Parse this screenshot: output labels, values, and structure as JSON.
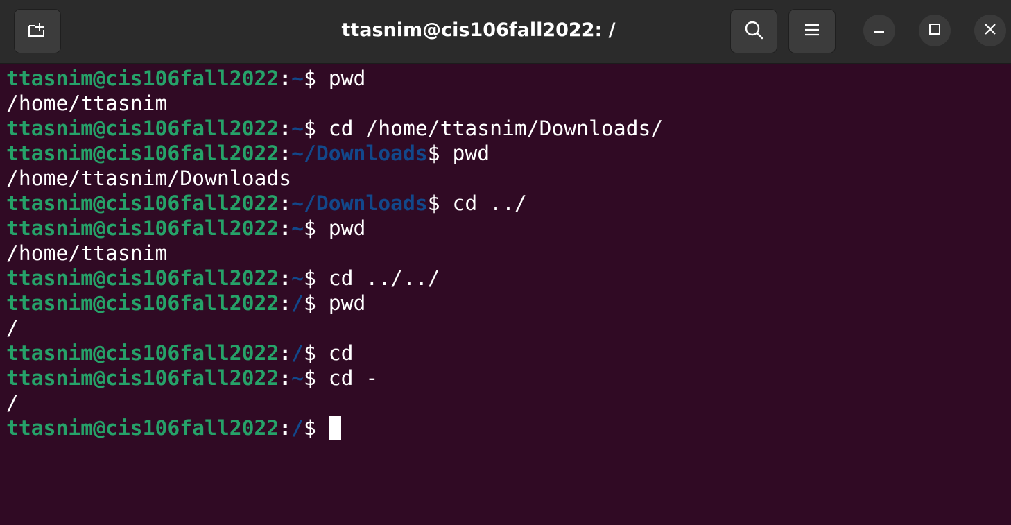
{
  "window": {
    "title": "ttasnim@cis106fall2022: /"
  },
  "titlebar": {
    "new_tab_icon": "new-tab-icon",
    "search_icon": "search-icon",
    "menu_icon": "hamburger-menu-icon",
    "minimize_icon": "minimize-icon",
    "maximize_icon": "maximize-icon",
    "close_icon": "close-icon"
  },
  "colors": {
    "background": "#300a24",
    "prompt_user": "#26a269",
    "prompt_path": "#12488b",
    "text": "#ffffff",
    "titlebar": "#2b2b2b"
  },
  "terminal": {
    "prompt_user": "ttasnim@cis106fall2022",
    "lines": [
      {
        "type": "prompt",
        "user": "ttasnim@cis106fall2022",
        "sep": ":",
        "path": "~",
        "sym": "$",
        "cmd": " pwd"
      },
      {
        "type": "output",
        "text": "/home/ttasnim"
      },
      {
        "type": "prompt",
        "user": "ttasnim@cis106fall2022",
        "sep": ":",
        "path": "~",
        "sym": "$",
        "cmd": " cd /home/ttasnim/Downloads/"
      },
      {
        "type": "prompt",
        "user": "ttasnim@cis106fall2022",
        "sep": ":",
        "path": "~/Downloads",
        "sym": "$",
        "cmd": " pwd"
      },
      {
        "type": "output",
        "text": "/home/ttasnim/Downloads"
      },
      {
        "type": "prompt",
        "user": "ttasnim@cis106fall2022",
        "sep": ":",
        "path": "~/Downloads",
        "sym": "$",
        "cmd": " cd ../"
      },
      {
        "type": "prompt",
        "user": "ttasnim@cis106fall2022",
        "sep": ":",
        "path": "~",
        "sym": "$",
        "cmd": " pwd"
      },
      {
        "type": "output",
        "text": "/home/ttasnim"
      },
      {
        "type": "prompt",
        "user": "ttasnim@cis106fall2022",
        "sep": ":",
        "path": "~",
        "sym": "$",
        "cmd": " cd ../../"
      },
      {
        "type": "prompt",
        "user": "ttasnim@cis106fall2022",
        "sep": ":",
        "path": "/",
        "sym": "$",
        "cmd": " pwd"
      },
      {
        "type": "output",
        "text": "/"
      },
      {
        "type": "prompt",
        "user": "ttasnim@cis106fall2022",
        "sep": ":",
        "path": "/",
        "sym": "$",
        "cmd": " cd"
      },
      {
        "type": "prompt",
        "user": "ttasnim@cis106fall2022",
        "sep": ":",
        "path": "~",
        "sym": "$",
        "cmd": " cd -"
      },
      {
        "type": "output",
        "text": "/"
      },
      {
        "type": "prompt",
        "user": "ttasnim@cis106fall2022",
        "sep": ":",
        "path": "/",
        "sym": "$",
        "cmd": " ",
        "cursor": true
      }
    ]
  }
}
